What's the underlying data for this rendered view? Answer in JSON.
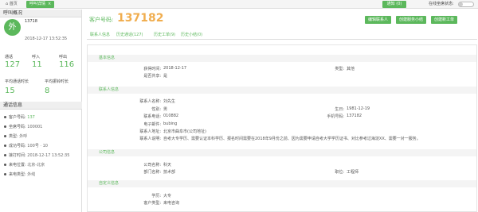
{
  "topbar": {
    "home_tab": "首页",
    "detail_tab": "呼叫详情",
    "detail_close": "×",
    "notify_button": "通知 (0)",
    "online_label": "在线坐席状态:"
  },
  "sidebar": {
    "title": "呼叫概况",
    "avatar_char": "外",
    "phone": "13718",
    "time": "2018-12-17 13:52:35",
    "stats_row1": [
      {
        "label": "通话",
        "value": "127"
      },
      {
        "label": "呼入",
        "value": "11"
      },
      {
        "label": "呼出",
        "value": "116"
      }
    ],
    "stats_row2": [
      {
        "label": "平均通话时长",
        "value": "15"
      },
      {
        "label": "平均振铃时长",
        "value": "8"
      }
    ],
    "call_info_title": "通话信息",
    "call_info": [
      {
        "label": "客户号码:",
        "value": "137"
      },
      {
        "label": "坐席号码:",
        "value": "100001"
      },
      {
        "label": "类型:",
        "value": "外呼"
      },
      {
        "label": "成功号码:",
        "value": "100号 · 10"
      },
      {
        "label": "接打时间:",
        "value": "2018-12-17 13:52:35"
      },
      {
        "label": "来电位置:",
        "value": "北京-北京"
      },
      {
        "label": "来电类型:",
        "value": "外线"
      }
    ]
  },
  "main": {
    "cust_label": "客户号码:",
    "cust_number": "137182",
    "actions": [
      "编辑联系人",
      "创建服务小结",
      "创建新工单"
    ],
    "tabs": [
      "联系人信息",
      "历史通话(127)",
      "历史工单(9)",
      "历史小结(0)"
    ],
    "sections": {
      "basic": {
        "title": "基本信息",
        "create_time_label": "获得时间:",
        "create_time": "2018-12-17",
        "type_label": "类型:",
        "type": "其他",
        "shared_label": "是否共享:",
        "shared": "是"
      },
      "contact": {
        "title": "联系人信息",
        "name_label": "联系人名称:",
        "name": "刘先生",
        "gender_label": "性别:",
        "gender": "男",
        "birth_label": "生日:",
        "birth": "1981-12-19",
        "phone_label": "联系电话:",
        "phone": "010882",
        "mobile_label": "手机号码:",
        "mobile": "137182",
        "email_label": "电子邮件:",
        "email": "bubing",
        "address_label": "联系人地址:",
        "address": "北京市曲阜市(公司地址)",
        "desc_label": "联系人说明:",
        "desc": "自考大专学历、需要认证本科学历、报名时间需要在2018年9月份之前、因为需要申请自考大学学历证书、对比参考过海淀XX、需要一对一服务。"
      },
      "company": {
        "title": "公司信息",
        "company_label": "公司名称:",
        "company": "科天",
        "dept_label": "部门名称:",
        "dept": "技术部",
        "position_label": "职位:",
        "position": "工程师"
      },
      "custom": {
        "title": "自定义信息",
        "edu_label": "学历:",
        "edu": "大专",
        "source_label": "客户类型:",
        "source": "来电咨询"
      }
    }
  },
  "colors": {
    "accent": "#5cb85c",
    "orange": "#f0ad4e"
  }
}
